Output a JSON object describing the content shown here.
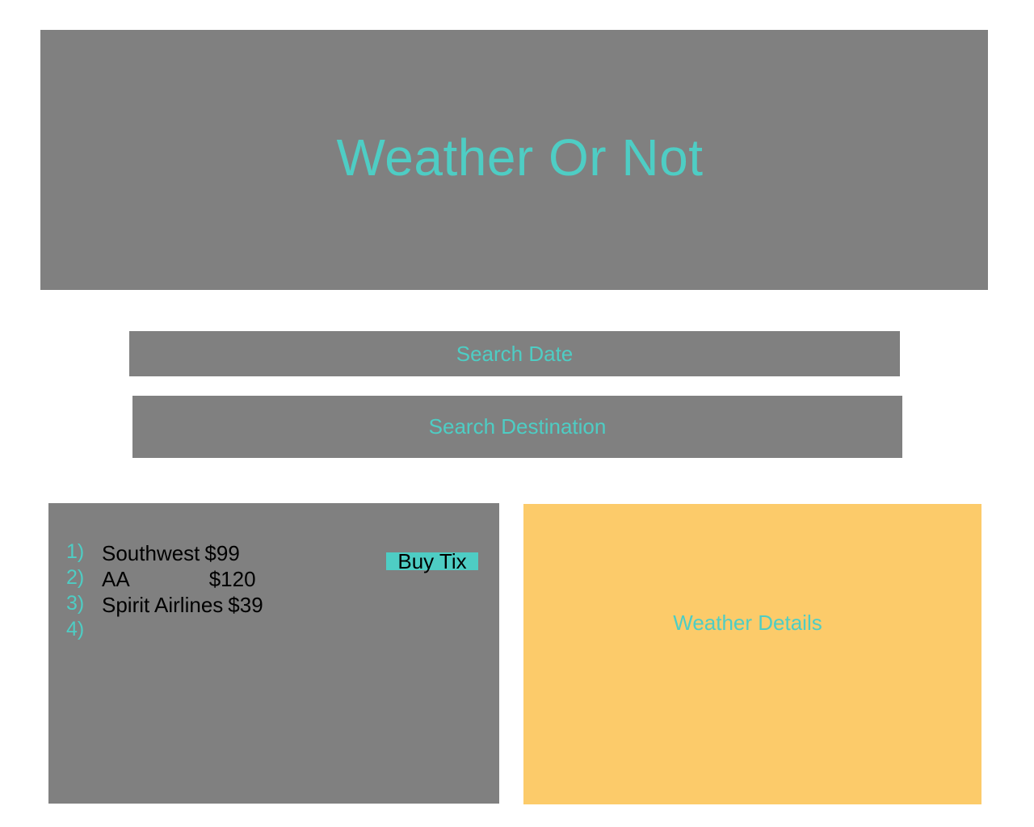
{
  "app": {
    "title": "Weather Or Not"
  },
  "search": {
    "date_placeholder": "Search Date",
    "destination_placeholder": "Search Destination"
  },
  "flights": {
    "items": [
      {
        "number": "1)",
        "airline": "Southwest",
        "price": "$99"
      },
      {
        "number": "2)",
        "airline": "AA",
        "price": "$120"
      },
      {
        "number": "3)",
        "airline": "Spirit Airlines",
        "price": "$39"
      },
      {
        "number": "4)",
        "airline": "",
        "price": ""
      }
    ],
    "buy_label": "Buy Tix"
  },
  "weather": {
    "title": "Weather Details"
  },
  "colors": {
    "panel_gray": "#808080",
    "accent_teal": "#4ecdc4",
    "weather_yellow": "#fccb6a"
  }
}
